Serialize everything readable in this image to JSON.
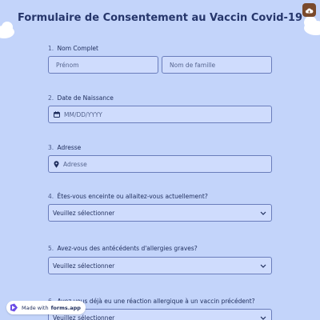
{
  "form": {
    "title": "Formulaire de Consentement au Vaccin Covid-19"
  },
  "questions": [
    {
      "number": "1.",
      "label": "Nom Complet"
    },
    {
      "number": "2.",
      "label": "Date de Naissance"
    },
    {
      "number": "3.",
      "label": "Adresse"
    },
    {
      "number": "4.",
      "label": "Êtes-vous enceinte ou allaitez-vous actuellement?"
    },
    {
      "number": "5.",
      "label": "Avez-vous des antécédents d'allergies graves?"
    },
    {
      "number": "6.",
      "label": "Avez-vous déjà eu une réaction allergique à un vaccin précédent?"
    }
  ],
  "fields": {
    "first_name_placeholder": "Prénom",
    "last_name_placeholder": "Nom de famille",
    "date_placeholder": "MM/DD/YYYY",
    "address_placeholder": "Adresse",
    "select_value": "Veuillez sélectionner"
  },
  "badge": {
    "prefix": "Made with",
    "brand": "forms.app"
  },
  "icons": {
    "corner": "cloud-icon",
    "date": "calendar-icon",
    "address": "location-pin-icon",
    "select": "chevron-down-icon",
    "badge_logo": "forms-app-logo-icon"
  },
  "colors": {
    "background": "#c3d4fa",
    "field_background": "#cfdcfd",
    "field_border": "#6a7dbb",
    "title": "#26366b",
    "text": "#1e2d5c",
    "corner_button": "#7a4a2c",
    "badge_logo": "#6b4de6"
  }
}
